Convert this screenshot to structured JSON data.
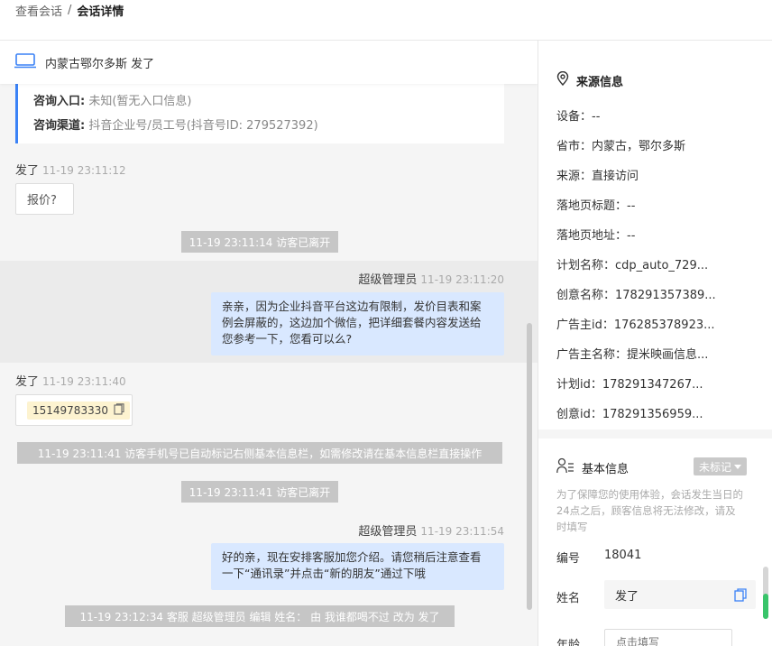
{
  "breadcrumb": {
    "parent": "查看会话",
    "separator": "/",
    "current": "会话详情"
  },
  "chat": {
    "header_name": "内蒙古鄂尔多斯  发了",
    "info_card": {
      "entry_label": "咨询入口:",
      "entry_value": "未知(暂无入口信息)",
      "channel_label": "咨询渠道:",
      "channel_value": "抖音企业号/员工号(抖音号ID:  279527392)"
    },
    "messages": [
      {
        "sender": "发了",
        "time": "11-19 23:11:12",
        "text": "报价?"
      },
      {
        "system": "11-19 23:11:14 访客已离开"
      },
      {
        "sender": "超级管理员",
        "time": "11-19 23:11:20",
        "line1": "亲亲，因为企业抖音平台这边有限制，发价目表和案",
        "line2": "例会屏蔽的，这边加个微信，把详细套餐内容发送给",
        "line3": "您参考一下，您看可以么?"
      },
      {
        "sender": "发了",
        "time": "11-19 23:11:40",
        "phone": "15149783330"
      },
      {
        "system": "11-19 23:11:41 访客手机号已自动标记右侧基本信息栏，如需修改请在基本信息栏直接操作"
      },
      {
        "system": "11-19 23:11:41 访客已离开"
      },
      {
        "sender": "超级管理员",
        "time": "11-19 23:11:54",
        "line1": "好的亲，现在安排客服加您介绍。请您稍后注意查看",
        "line2": "一下“通讯录”并点击“新的朋友”通过下哦"
      },
      {
        "system": "11-19 23:12:34 客服 超级管理员 编辑 姓名： 由 我谁都喝不过 改为 发了"
      }
    ]
  },
  "panel": {
    "source_title": "来源信息",
    "source_rows": [
      "设备：--",
      "省市：内蒙古，鄂尔多斯",
      "来源：直接访问",
      "落地页标题：--",
      "落地页地址：--",
      "计划名称：cdp_auto_729...",
      "创意名称：178291357389...",
      "广告主id：176285378923...",
      "广告主名称：提米映画信息...",
      "计划id：178291347267...",
      "创意id：178291356959..."
    ],
    "basic_title": "基本信息",
    "tag_label": "未标记",
    "notice": "为了保障您的使用体验，会话发生当日的24点之后，顾客信息将无法修改，请及时填写",
    "id_label": "编号",
    "id_value": "18041",
    "name_label": "姓名",
    "name_value": "发了",
    "age_label": "年龄",
    "age_placeholder": "点击填写"
  }
}
